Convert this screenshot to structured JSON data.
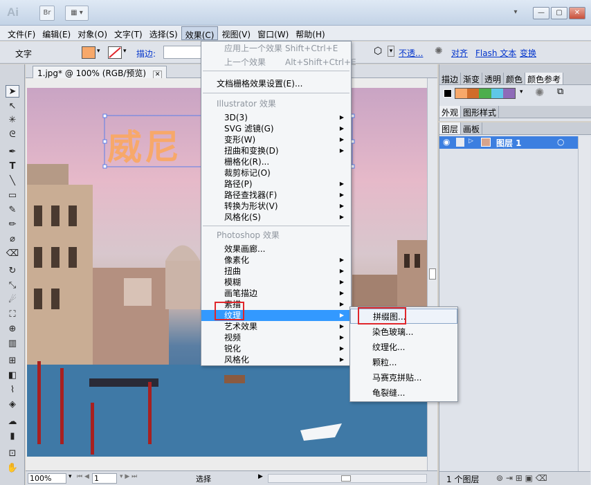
{
  "app": {
    "logo": "Ai",
    "br_label": "Br"
  },
  "menubar": [
    "文件(F)",
    "编辑(E)",
    "对象(O)",
    "文字(T)",
    "选择(S)",
    "效果(C)",
    "视图(V)",
    "窗口(W)",
    "帮助(H)"
  ],
  "controlbar": {
    "type_label": "文字",
    "stroke_label": "描边:",
    "opacity_label": "不透...",
    "align_label": "对齐",
    "flash_label": "Flash 文本",
    "transform_label": "变换"
  },
  "document": {
    "tab": "1.jpg* @ 100% (RGB/预览)",
    "zoom": "100%",
    "page": "1",
    "status_mode": "选择",
    "watermark_text": "威尼"
  },
  "effect_menu": {
    "items": [
      {
        "label": "应用上一个效果",
        "shortcut": "Shift+Ctrl+E",
        "state": "disabled"
      },
      {
        "label": "上一个效果",
        "shortcut": "Alt+Shift+Ctrl+E",
        "state": "disabled"
      },
      {
        "label": "文档栅格效果设置(E)...",
        "state": "normal"
      },
      {
        "label": "Illustrator 效果",
        "state": "header"
      },
      {
        "label": "3D(3)",
        "state": "normal",
        "submenu": true
      },
      {
        "label": "SVG 滤镜(G)",
        "state": "normal",
        "submenu": true
      },
      {
        "label": "变形(W)",
        "state": "normal",
        "submenu": true
      },
      {
        "label": "扭曲和变换(D)",
        "state": "normal",
        "submenu": true
      },
      {
        "label": "栅格化(R)...",
        "state": "normal"
      },
      {
        "label": "裁剪标记(O)",
        "state": "normal"
      },
      {
        "label": "路径(P)",
        "state": "normal",
        "submenu": true
      },
      {
        "label": "路径查找器(F)",
        "state": "normal",
        "submenu": true
      },
      {
        "label": "转换为形状(V)",
        "state": "normal",
        "submenu": true
      },
      {
        "label": "风格化(S)",
        "state": "normal",
        "submenu": true
      },
      {
        "label": "Photoshop 效果",
        "state": "header"
      },
      {
        "label": "效果画廊...",
        "state": "normal"
      },
      {
        "label": "像素化",
        "state": "normal",
        "submenu": true
      },
      {
        "label": "扭曲",
        "state": "normal",
        "submenu": true
      },
      {
        "label": "模糊",
        "state": "normal",
        "submenu": true
      },
      {
        "label": "画笔描边",
        "state": "normal",
        "submenu": true
      },
      {
        "label": "素描",
        "state": "normal",
        "submenu": true
      },
      {
        "label": "纹理",
        "state": "highlighted",
        "submenu": true
      },
      {
        "label": "艺术效果",
        "state": "normal",
        "submenu": true
      },
      {
        "label": "视频",
        "state": "normal",
        "submenu": true
      },
      {
        "label": "锐化",
        "state": "normal",
        "submenu": true
      },
      {
        "label": "风格化",
        "state": "normal",
        "submenu": true
      }
    ]
  },
  "texture_submenu": [
    "拼缀图...",
    "染色玻璃...",
    "纹理化...",
    "颗粒...",
    "马赛克拼贴...",
    "龟裂缝..."
  ],
  "panels": {
    "top_tabs": [
      "描边",
      "渐变",
      "透明",
      "颜色",
      "颜色参考"
    ],
    "appearance_tabs": [
      "外观",
      "图形样式"
    ],
    "layers_tabs": [
      "图层",
      "画板"
    ],
    "layer_name": "图层 1",
    "layer_count": "1 个图层"
  },
  "colors": {
    "fill_swatch": "#f7a86a",
    "highlight": "#3399ff",
    "annotation": "#e0262b",
    "guide_swatches": [
      "#d97a3a",
      "#d06c2a",
      "#4cae4c",
      "#5fc7e8",
      "#8e6bb8"
    ]
  }
}
